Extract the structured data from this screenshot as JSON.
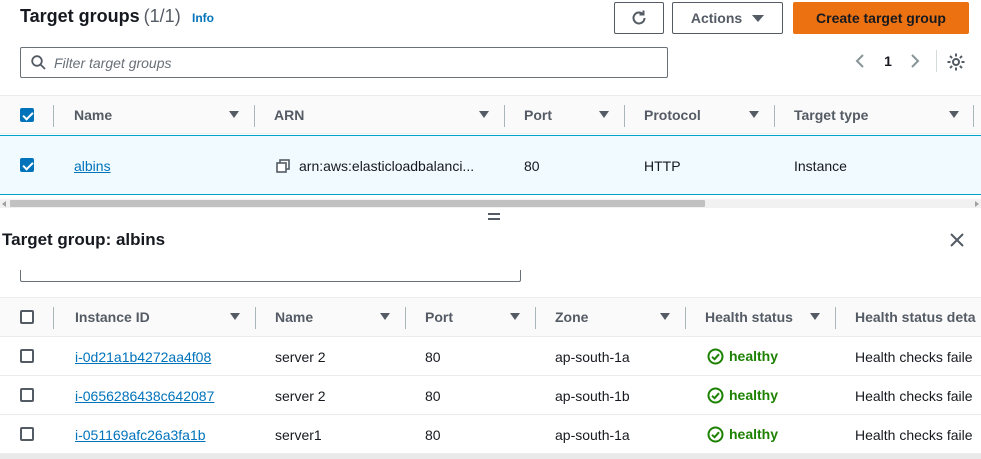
{
  "header": {
    "title": "Target groups",
    "count": "(1/1)",
    "info_label": "Info",
    "actions_label": "Actions",
    "create_label": "Create target group"
  },
  "filter": {
    "placeholder": "Filter target groups"
  },
  "pagination": {
    "current_page": "1"
  },
  "target_groups_table": {
    "columns": [
      "Name",
      "ARN",
      "Port",
      "Protocol",
      "Target type"
    ],
    "rows": [
      {
        "name": "albins",
        "arn": "arn:aws:elasticloadbalanci...",
        "port": "80",
        "protocol": "HTTP",
        "target_type": "Instance",
        "selected": true
      }
    ]
  },
  "details_panel": {
    "title": "Target group: albins",
    "instances_table": {
      "columns": [
        "Instance ID",
        "Name",
        "Port",
        "Zone",
        "Health status",
        "Health status deta"
      ],
      "rows": [
        {
          "instance_id": "i-0d21a1b4272aa4f08",
          "name": "server 2",
          "port": "80",
          "zone": "ap-south-1a",
          "health_status": "healthy",
          "health_details": "Health checks faile"
        },
        {
          "instance_id": "i-0656286438c642087",
          "name": "server 2",
          "port": "80",
          "zone": "ap-south-1b",
          "health_status": "healthy",
          "health_details": "Health checks faile"
        },
        {
          "instance_id": "i-051169afc26a3fa1b",
          "name": "server1",
          "port": "80",
          "zone": "ap-south-1a",
          "health_status": "healthy",
          "health_details": "Health checks faile"
        }
      ]
    }
  },
  "colors": {
    "primary_button": "#ec7211",
    "link": "#0073bb",
    "healthy": "#1d8102",
    "selected_row_bg": "#f1faff"
  },
  "icons": {
    "refresh": "refresh-icon",
    "actions_caret": "caret-down-icon",
    "search": "search-icon",
    "prev_page": "chevron-left-icon",
    "next_page": "chevron-right-icon",
    "settings": "gear-icon",
    "copy": "copy-icon",
    "close": "close-icon",
    "healthy": "check-circle-icon"
  }
}
